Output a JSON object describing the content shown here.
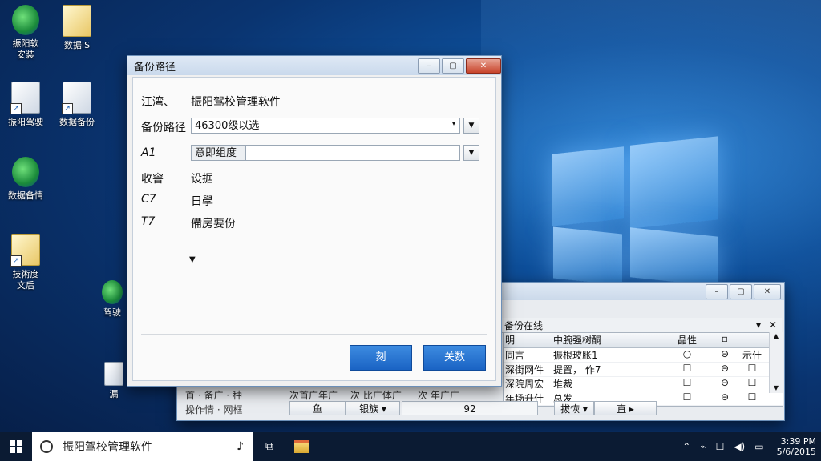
{
  "desktop_icons": [
    {
      "label": "振阳软\n安装"
    },
    {
      "label": "数据IS"
    },
    {
      "label": "振阳驾驶"
    },
    {
      "label": "数据备份"
    },
    {
      "label": "数据备情"
    },
    {
      "label": "技術度\n文后"
    },
    {
      "label": "驾驶"
    },
    {
      "label": "漏"
    }
  ],
  "dialog": {
    "title": "备份路径",
    "rows": [
      {
        "label": "江湾、",
        "value": "振阳驾校管理软件"
      },
      {
        "label": "备份路径",
        "value": "46300级以选"
      },
      {
        "label": "A1",
        "value": "意即组度"
      },
      {
        "label": "收窨",
        "value": "设据"
      },
      {
        "label": "C7",
        "value": "日學"
      },
      {
        "label": "T7",
        "value": "備房要份"
      }
    ],
    "ok_label": "刻",
    "cancel_label": "关数"
  },
  "back_window": {
    "panel_title": "备份在线",
    "columns": [
      "明",
      "中腕强树酮",
      "晶性",
      "",
      ""
    ],
    "rows": [
      [
        "同言",
        "振根玻胀1",
        "○",
        "⊖",
        "示什"
      ],
      [
        "深街网件",
        "提置，  作7",
        "☐",
        "⊖",
        "☐"
      ],
      [
        "深院周宏",
        "堆裁",
        "☐",
        "⊖",
        "☐"
      ],
      [
        "年场升什",
        "总发",
        "☐",
        "⊖",
        "☐"
      ]
    ],
    "left_labels": [
      "首 · 备广 · 种",
      "操作情 · 网框"
    ],
    "mid_labels": [
      "次首广年广",
      "次 比广体广",
      "次 年广广"
    ],
    "bottom_bar": {
      "btn1": "鱼",
      "btn2": "银族",
      "field": "92",
      "btn3": "拔恢",
      "btn4": "直"
    }
  },
  "taskbar": {
    "search_text": "振阳驾校管理软件",
    "time": "3:39 PM",
    "date": "5/6/2015"
  }
}
